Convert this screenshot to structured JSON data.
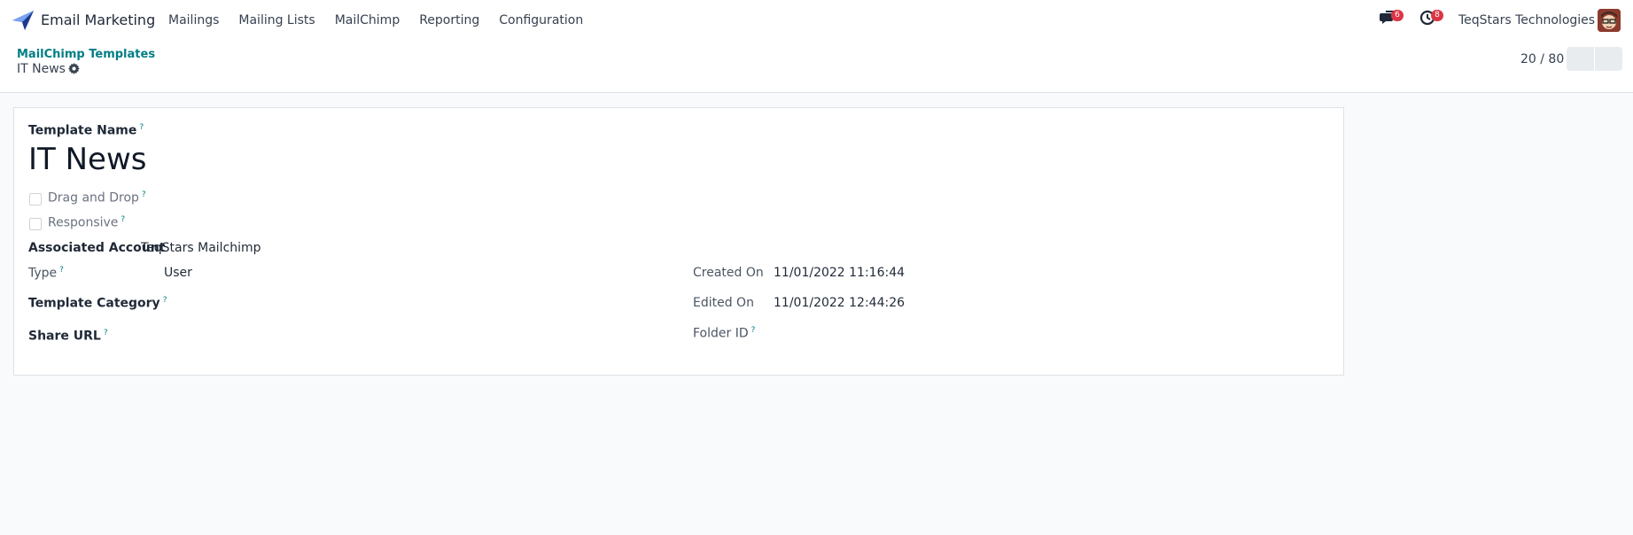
{
  "navbar": {
    "app_name": "Email Marketing",
    "menu": [
      "Mailings",
      "Mailing Lists",
      "MailChimp",
      "Reporting",
      "Configuration"
    ],
    "messages_count": "6",
    "activities_count": "8",
    "company": "TeqStars Technologies",
    "brand_color": "#017e84",
    "badge_color": "#dc3545"
  },
  "control_panel": {
    "breadcrumb": "MailChimp Templates",
    "record_title": "IT News",
    "pager": "20 / 80"
  },
  "form": {
    "template_name_label": "Template Name",
    "template_name_value": "IT News",
    "drag_and_drop_label": "Drag and Drop",
    "drag_and_drop_checked": false,
    "responsive_label": "Responsive",
    "responsive_checked": false,
    "associated_account_label": "Associated Account",
    "associated_account_value": "TeqStars Mailchimp",
    "type_label": "Type",
    "type_value": "User",
    "template_category_label": "Template Category",
    "share_url_label": "Share URL",
    "created_on_label": "Created On",
    "created_on_value": "11/01/2022 11:16:44",
    "edited_on_label": "Edited On",
    "edited_on_value": "11/01/2022 12:44:26",
    "folder_id_label": "Folder ID",
    "help_mark": "?"
  }
}
